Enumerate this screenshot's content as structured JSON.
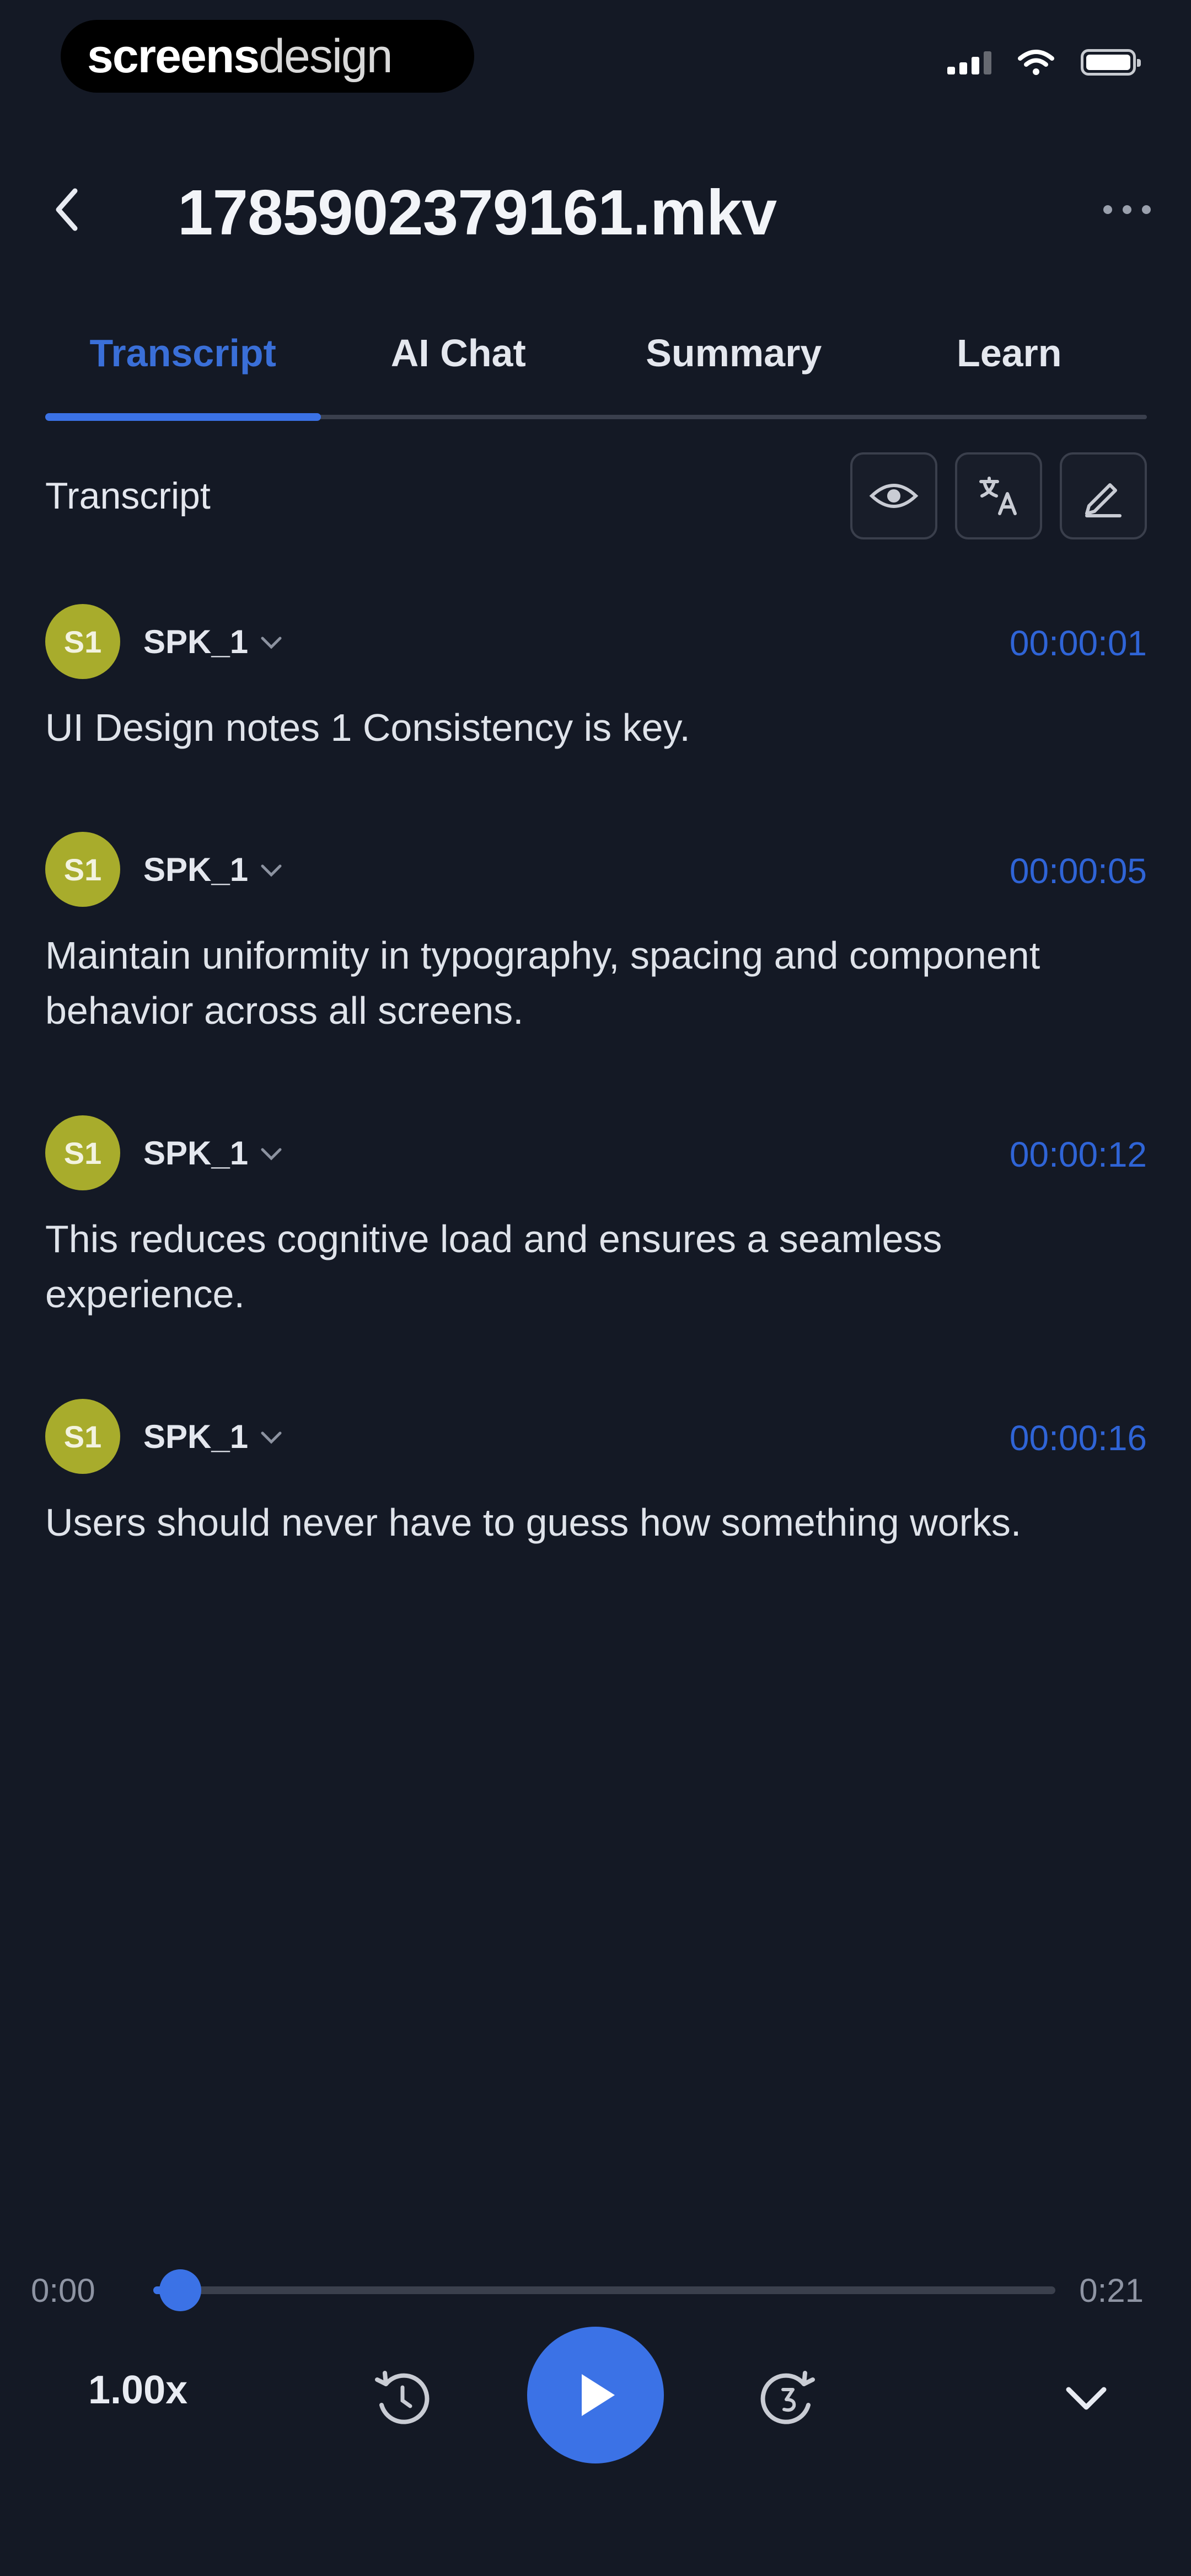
{
  "status_bar": {
    "brand_bold": "screens",
    "brand_light": "design"
  },
  "header": {
    "title": "1785902379161.mkv"
  },
  "tabs": [
    {
      "label": "Transcript",
      "active": true
    },
    {
      "label": "AI Chat",
      "active": false
    },
    {
      "label": "Summary",
      "active": false
    },
    {
      "label": "Learn",
      "active": false
    }
  ],
  "transcript": {
    "section_label": "Transcript",
    "entries": [
      {
        "avatar": "S1",
        "speaker": "SPK_1",
        "time": "00:00:01",
        "text": "UI Design notes 1 Consistency is key."
      },
      {
        "avatar": "S1",
        "speaker": "SPK_1",
        "time": "00:00:05",
        "text": "Maintain uniformity in typography, spacing and component behavior across all screens."
      },
      {
        "avatar": "S1",
        "speaker": "SPK_1",
        "time": "00:00:12",
        "text": "This reduces cognitive load and ensures a seamless experience."
      },
      {
        "avatar": "S1",
        "speaker": "SPK_1",
        "time": "00:00:16",
        "text": "Users should never have to guess how something works."
      }
    ]
  },
  "player": {
    "current_time": "0:00",
    "total_time": "0:21",
    "progress_fraction": 0.03,
    "speed": "1.00x"
  },
  "colors": {
    "accent": "#3b72e6",
    "avatar": "#a8ac2c",
    "background": "#141925"
  }
}
